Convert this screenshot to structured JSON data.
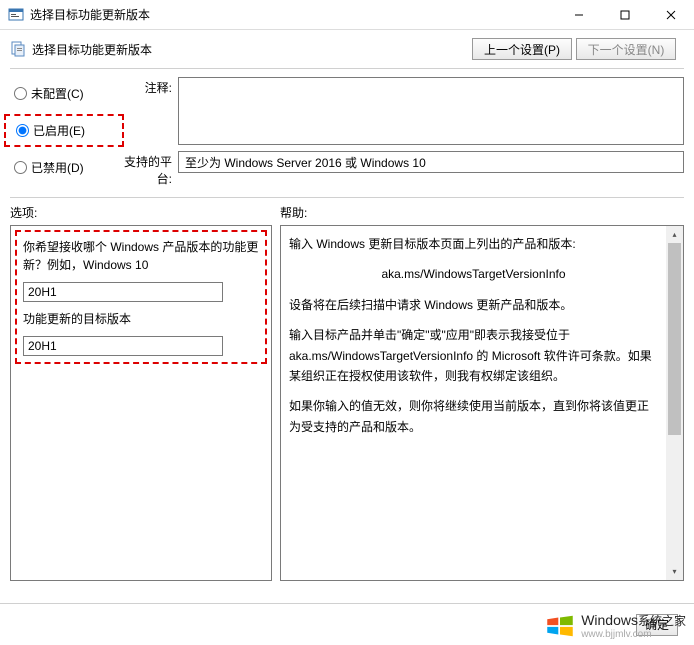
{
  "titlebar": {
    "title": "选择目标功能更新版本"
  },
  "subtitle": {
    "text": "选择目标功能更新版本",
    "prev_btn": "上一个设置(P)",
    "next_btn": "下一个设置(N)"
  },
  "radios": {
    "not_configured": "未配置(C)",
    "enabled": "已启用(E)",
    "disabled": "已禁用(D)"
  },
  "fields": {
    "comment_label": "注释:",
    "platform_label": "支持的平台:",
    "platform_value": "至少为 Windows Server 2016 或 Windows 10"
  },
  "section_labels": {
    "options": "选项:",
    "help": "帮助:"
  },
  "options": {
    "product_question": "你希望接收哪个 Windows 产品版本的功能更新？例如，Windows 10",
    "product_value": "20H1",
    "target_label": "功能更新的目标版本",
    "target_value": "20H1"
  },
  "help": {
    "p1": "输入 Windows 更新目标版本页面上列出的产品和版本:",
    "link": "aka.ms/WindowsTargetVersionInfo",
    "p2": "设备将在后续扫描中请求 Windows 更新产品和版本。",
    "p3": "输入目标产品并单击\"确定\"或\"应用\"即表示我接受位于 aka.ms/WindowsTargetVersionInfo 的 Microsoft 软件许可条款。如果某组织正在授权使用该软件，则我有权绑定该组织。",
    "p4": "如果你输入的值无效，则你将继续使用当前版本，直到你将该值更正为受支持的产品和版本。"
  },
  "buttons": {
    "ok": "确定"
  },
  "watermark": {
    "brand": "Windows",
    "sub": "系统之家",
    "url": "www.bjjmlv.com"
  }
}
